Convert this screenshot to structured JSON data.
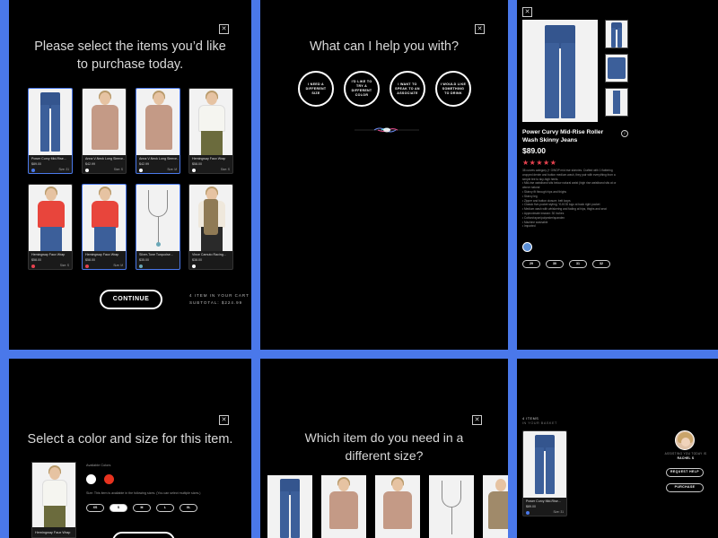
{
  "panel1": {
    "title_line1": "Please select the items you’d like",
    "title_line2": "to purchase today.",
    "close_glyph": "✕",
    "items": [
      {
        "name": "Power Curvy Mid-Rise...",
        "price": "$89.00",
        "size": "Size: 31",
        "dot": "#4a78ea",
        "selected": true
      },
      {
        "name": "Anna V-Neck Long Sleeve...",
        "price": "$42.99",
        "size": "Size: S",
        "dot": "#fff",
        "selected": false
      },
      {
        "name": "Anna V-Neck Long Sleeve...",
        "price": "$42.99",
        "size": "Size: M",
        "dot": "#fff",
        "selected": true
      },
      {
        "name": "Hemingway Faux Wrap",
        "price": "$58.00",
        "size": "Size: S",
        "dot": "#fff",
        "selected": false
      },
      {
        "name": "Hemingway Faux Wrap",
        "price": "$58.00",
        "size": "Size: S",
        "dot": "#e8424f",
        "selected": false
      },
      {
        "name": "Hemingway Faux Wrap",
        "price": "$58.00",
        "size": "Size: M",
        "dot": "#e8424f",
        "selected": true
      },
      {
        "name": "Silver-Tone Turquoise...",
        "price": "$35.00",
        "size": "",
        "dot": "#6aa8b8",
        "selected": true
      },
      {
        "name": "Vince Camuto Racing...",
        "price": "$38.00",
        "size": "",
        "dot": "#fff",
        "selected": false
      }
    ],
    "continue_label": "CONTINUE",
    "cart_count": "4 ITEM IN YOUR CART",
    "subtotal": "SUBTOTAL: $224.99"
  },
  "panel2": {
    "title": "What can I help you with?",
    "close_glyph": "✕",
    "options": [
      "I NEED A DIFFERENT SIZE",
      "I'D LIKE TO TRY A DIFFERENT COLOR",
      "I WANT TO SPEAK TO AN ASSOCIATE",
      "I WOULD LIKE SOMETHING TO DRINK"
    ]
  },
  "panel3": {
    "close_glyph": "✕",
    "product_name_line1": "Power Curvy Mid-Rise Roller",
    "product_name_line2": "Wash Skinny Jeans",
    "price": "$89.00",
    "info_glyph": "i",
    "stars": "★★★★★",
    "rating": 5,
    "description": [
      "38 curves category (+ GWOP mid rise skinnies. Crafted with 1 flattering",
      "cropped denim and button medium wash, they pair with everything from a",
      "simple tee to sky-high heels.",
      "• Mid-rise waistband sits below natural waist (high rise waistband sits at or",
      "above natural",
      "• Skinny fit through hips and thighs",
      "• Skinny leg",
      "• Zipper and button closure; belt loops",
      "• Classic five-pocket styling; YLKOD logo at back right pocket",
      "• Medium wash with whiskering and fading at hips, thighs and seat",
      "• Approximate inseam: 30 inches",
      "• Cotton/rayon/polyester/spandex",
      "• Machine washable",
      "• Imported"
    ],
    "swatch_color": "#5b8fd6",
    "sizes": [
      "29",
      "30",
      "31",
      "32"
    ]
  },
  "panel4": {
    "title": "Select a color and size for this item.",
    "close_glyph": "✕",
    "available_colors_label": "Available Colors",
    "colors": [
      "#ffffff",
      "#e8331f"
    ],
    "size_note": "Size: This item is available in the following sizes. (You can select multiple sizes.)",
    "sizes": [
      "XS",
      "S",
      "M",
      "L",
      "XL"
    ],
    "item_name": "Hemingway Faux Wrap"
  },
  "panel5": {
    "title_line1": "Which item do you need in a",
    "title_line2": "different size?",
    "close_glyph": "✕"
  },
  "panel6": {
    "items_count": "4 ITEMS",
    "items_sub": "IN YOUR BASKET",
    "assist_label": "ASSISTING YOU TODAY IS",
    "assistant_name": "RACHEL S",
    "request_help": "REQUEST HELP",
    "purchase": "PURCHASE",
    "card": {
      "name": "Power Curvy Mid-Rise...",
      "price": "$89.00",
      "size": "Size: 31",
      "dot": "#4a78ea"
    }
  }
}
